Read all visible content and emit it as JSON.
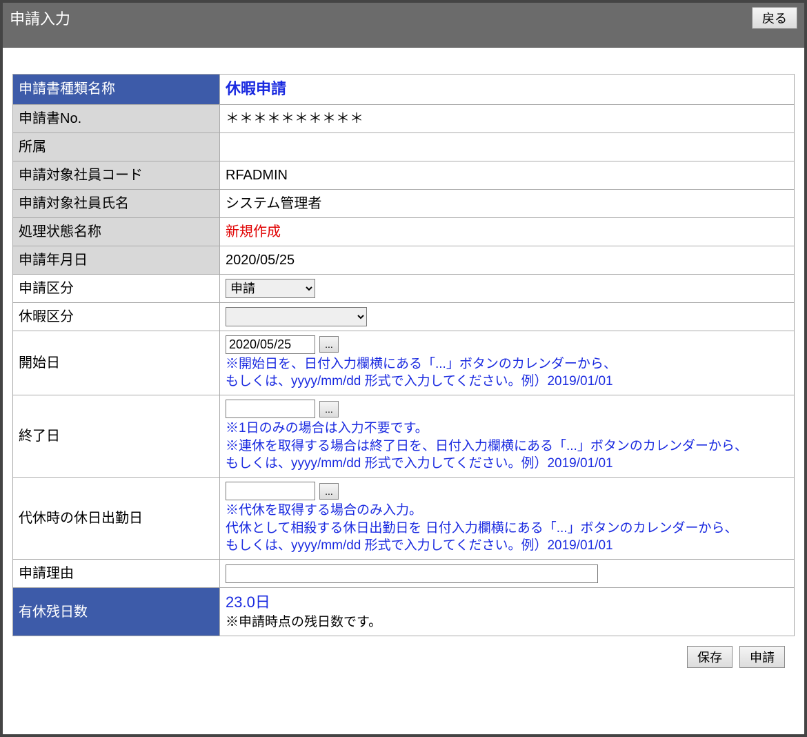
{
  "header": {
    "title": "申請入力",
    "back_label": "戻る"
  },
  "rows": {
    "form_type": {
      "label": "申請書種類名称",
      "value": "休暇申請"
    },
    "form_no": {
      "label": "申請書No.",
      "value": "＊＊＊＊＊＊＊＊＊＊"
    },
    "department": {
      "label": "所属",
      "value": ""
    },
    "emp_code": {
      "label": "申請対象社員コード",
      "value": "RFADMIN"
    },
    "emp_name": {
      "label": "申請対象社員氏名",
      "value": "システム管理者"
    },
    "status": {
      "label": "処理状態名称",
      "value": "新規作成"
    },
    "app_date": {
      "label": "申請年月日",
      "value": "2020/05/25"
    },
    "app_type": {
      "label": "申請区分",
      "selected": "申請"
    },
    "leave_type": {
      "label": "休暇区分",
      "selected": ""
    },
    "start_date": {
      "label": "開始日",
      "value": "2020/05/25",
      "help1": "※開始日を、日付入力欄横にある「...」ボタンのカレンダーから、",
      "help2": "もしくは、yyyy/mm/dd 形式で入力してください。例）2019/01/01"
    },
    "end_date": {
      "label": "終了日",
      "value": "",
      "help1": "※1日のみの場合は入力不要です。",
      "help2": "※連休を取得する場合は終了日を、日付入力欄横にある「...」ボタンのカレンダーから、",
      "help3": "もしくは、yyyy/mm/dd 形式で入力してください。例）2019/01/01"
    },
    "substitute_date": {
      "label": "代休時の休日出勤日",
      "value": "",
      "help1": "※代休を取得する場合のみ入力。",
      "help2": "代休として相殺する休日出勤日を 日付入力欄横にある「...」ボタンのカレンダーから、",
      "help3": "もしくは、yyyy/mm/dd 形式で入力してください。例）2019/01/01"
    },
    "reason": {
      "label": "申請理由",
      "value": ""
    },
    "remaining": {
      "label": "有休残日数",
      "value": "23.0日",
      "note": "※申請時点の残日数です。"
    }
  },
  "buttons": {
    "calendar": "...",
    "save": "保存",
    "submit": "申請"
  }
}
